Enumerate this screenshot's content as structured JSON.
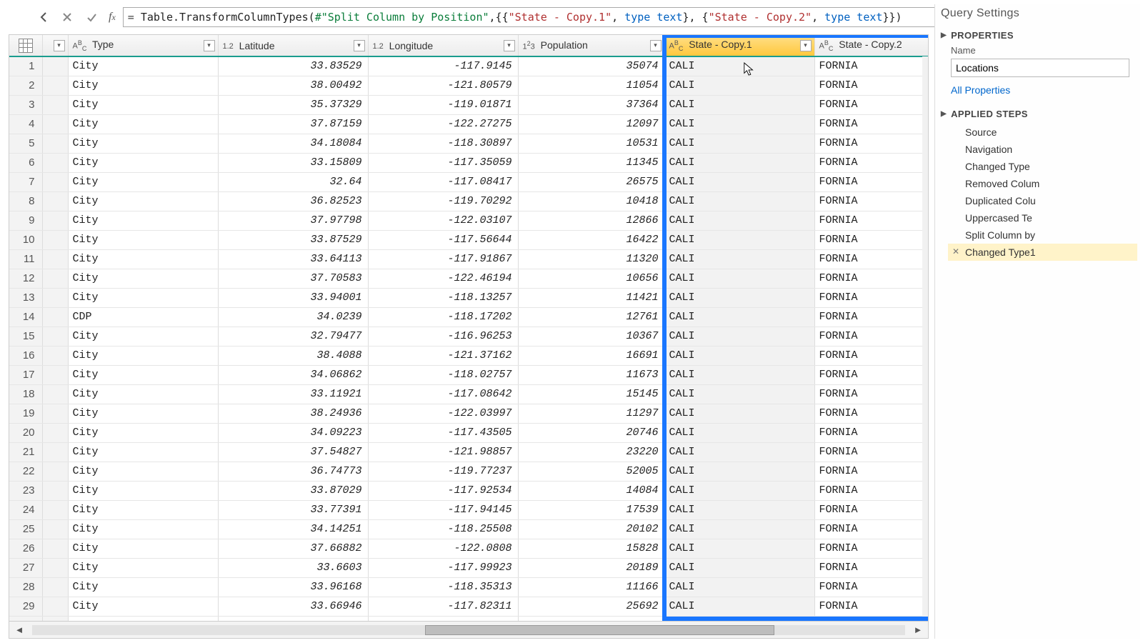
{
  "formula": {
    "text": "= Table.TransformColumnTypes(#\"Split Column by Position\",{{\"State - Copy.1\", type text}, {\"State - Copy.2\", type text}})"
  },
  "columns": [
    {
      "name": "Type",
      "typetag": "ABC",
      "align": "txt"
    },
    {
      "name": "Latitude",
      "typetag": "1.2",
      "align": "num"
    },
    {
      "name": "Longitude",
      "typetag": "1.2",
      "align": "num"
    },
    {
      "name": "Population",
      "typetag": "123",
      "align": "num"
    },
    {
      "name": "State - Copy.1",
      "typetag": "ABC",
      "align": "txt",
      "selected": true
    },
    {
      "name": "State - Copy.2",
      "typetag": "ABC",
      "align": "txt"
    }
  ],
  "rows": [
    [
      "City",
      "33.83529",
      "-117.9145",
      "35074",
      "CALI",
      "FORNIA"
    ],
    [
      "City",
      "38.00492",
      "-121.80579",
      "11054",
      "CALI",
      "FORNIA"
    ],
    [
      "City",
      "35.37329",
      "-119.01871",
      "37364",
      "CALI",
      "FORNIA"
    ],
    [
      "City",
      "37.87159",
      "-122.27275",
      "12097",
      "CALI",
      "FORNIA"
    ],
    [
      "City",
      "34.18084",
      "-118.30897",
      "10531",
      "CALI",
      "FORNIA"
    ],
    [
      "City",
      "33.15809",
      "-117.35059",
      "11345",
      "CALI",
      "FORNIA"
    ],
    [
      "City",
      "32.64",
      "-117.08417",
      "26575",
      "CALI",
      "FORNIA"
    ],
    [
      "City",
      "36.82523",
      "-119.70292",
      "10418",
      "CALI",
      "FORNIA"
    ],
    [
      "City",
      "37.97798",
      "-122.03107",
      "12866",
      "CALI",
      "FORNIA"
    ],
    [
      "City",
      "33.87529",
      "-117.56644",
      "16422",
      "CALI",
      "FORNIA"
    ],
    [
      "City",
      "33.64113",
      "-117.91867",
      "11320",
      "CALI",
      "FORNIA"
    ],
    [
      "City",
      "37.70583",
      "-122.46194",
      "10656",
      "CALI",
      "FORNIA"
    ],
    [
      "City",
      "33.94001",
      "-118.13257",
      "11421",
      "CALI",
      "FORNIA"
    ],
    [
      "CDP",
      "34.0239",
      "-118.17202",
      "12761",
      "CALI",
      "FORNIA"
    ],
    [
      "City",
      "32.79477",
      "-116.96253",
      "10367",
      "CALI",
      "FORNIA"
    ],
    [
      "City",
      "38.4088",
      "-121.37162",
      "16691",
      "CALI",
      "FORNIA"
    ],
    [
      "City",
      "34.06862",
      "-118.02757",
      "11673",
      "CALI",
      "FORNIA"
    ],
    [
      "City",
      "33.11921",
      "-117.08642",
      "15145",
      "CALI",
      "FORNIA"
    ],
    [
      "City",
      "38.24936",
      "-122.03997",
      "11297",
      "CALI",
      "FORNIA"
    ],
    [
      "City",
      "34.09223",
      "-117.43505",
      "20746",
      "CALI",
      "FORNIA"
    ],
    [
      "City",
      "37.54827",
      "-121.98857",
      "23220",
      "CALI",
      "FORNIA"
    ],
    [
      "City",
      "36.74773",
      "-119.77237",
      "52005",
      "CALI",
      "FORNIA"
    ],
    [
      "City",
      "33.87029",
      "-117.92534",
      "14084",
      "CALI",
      "FORNIA"
    ],
    [
      "City",
      "33.77391",
      "-117.94145",
      "17539",
      "CALI",
      "FORNIA"
    ],
    [
      "City",
      "34.14251",
      "-118.25508",
      "20102",
      "CALI",
      "FORNIA"
    ],
    [
      "City",
      "37.66882",
      "-122.0808",
      "15828",
      "CALI",
      "FORNIA"
    ],
    [
      "City",
      "33.6603",
      "-117.99923",
      "20189",
      "CALI",
      "FORNIA"
    ],
    [
      "City",
      "33.96168",
      "-118.35313",
      "11166",
      "CALI",
      "FORNIA"
    ],
    [
      "City",
      "33.66946",
      "-117.82311",
      "25692",
      "CALI",
      "FORNIA"
    ],
    [
      "",
      "",
      "",
      "",
      "",
      ""
    ]
  ],
  "settings": {
    "title": "Query Settings",
    "properties_hdr": "PROPERTIES",
    "name_label": "Name",
    "name_value": "Locations",
    "all_properties": "All Properties",
    "steps_hdr": "APPLIED STEPS",
    "steps": [
      "Source",
      "Navigation",
      "Changed Type",
      "Removed Colum",
      "Duplicated Colu",
      "Uppercased Te",
      "Split Column by",
      "Changed Type1"
    ],
    "active_step_index": 7
  }
}
